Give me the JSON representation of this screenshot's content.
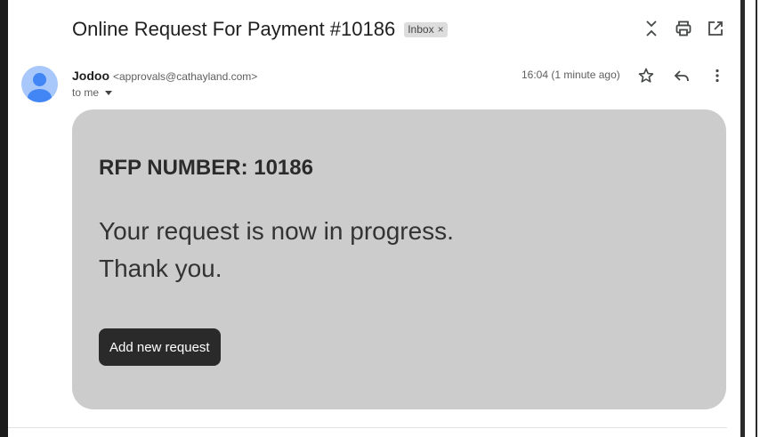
{
  "email": {
    "subject": "Online Request For Payment #10186",
    "label": "Inbox",
    "label_remove": "×",
    "sender_name": "Jodoo",
    "sender_email": "<approvals@cathayland.com>",
    "recipient": "to me",
    "timestamp": "16:04 (1 minute ago)"
  },
  "body": {
    "rfp_line": "RFP NUMBER: 10186",
    "message_line1": "Your request is now in progress.",
    "message_line2": "Thank you.",
    "button_label": "Add new request"
  },
  "icons": {
    "collapse": "collapse-icon",
    "print": "print-icon",
    "open_new_window": "open-in-new-window-icon",
    "star": "star-icon",
    "reply": "reply-icon",
    "more": "more-vertical-icon"
  },
  "colors": {
    "card_bg": "#cccccc",
    "button_bg": "#2a2a2a",
    "avatar_bg": "#a8c7fa",
    "avatar_fg": "#4285f4"
  }
}
